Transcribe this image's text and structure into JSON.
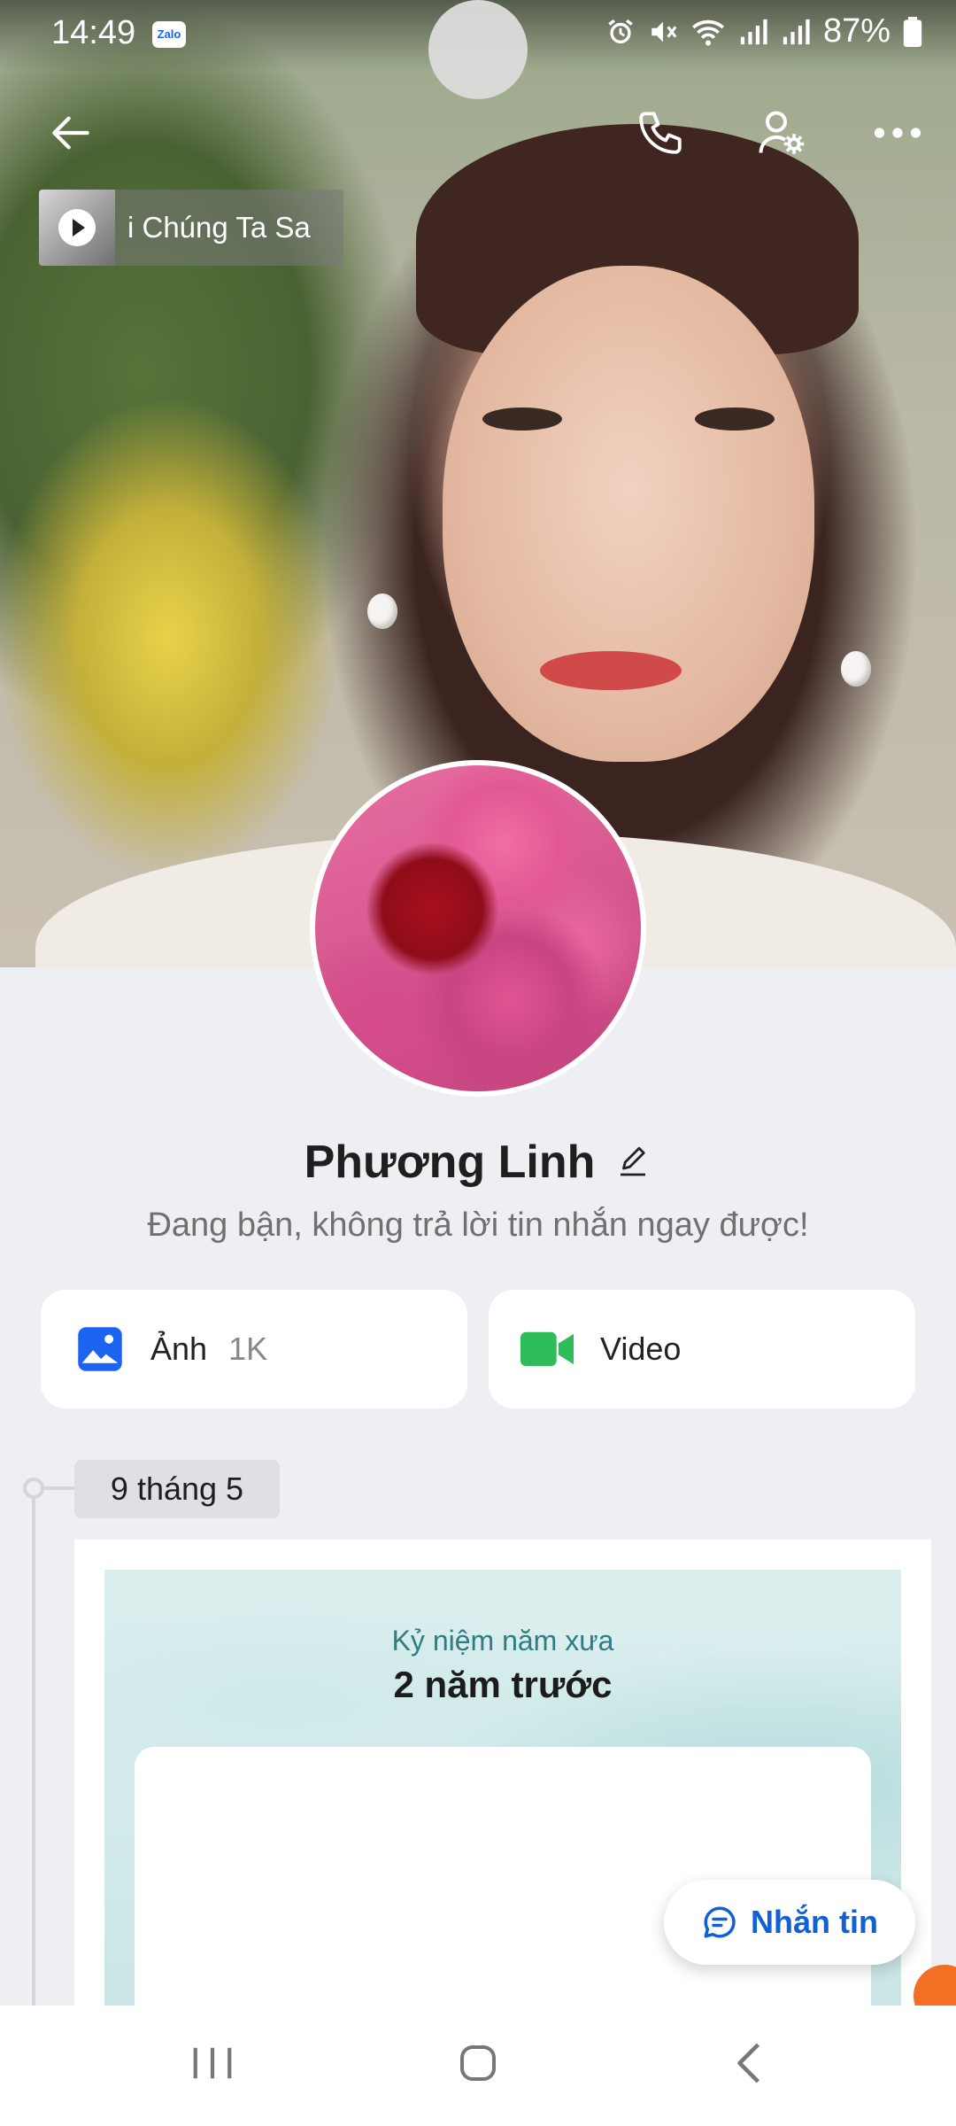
{
  "status_bar": {
    "time": "14:49",
    "app_badge": "Zalo",
    "battery": "87%"
  },
  "music": {
    "title": "i Chúng Ta Sa"
  },
  "profile": {
    "name": "Phương Linh",
    "status": "Đang bận, không trả lời tin nhắn ngay được!"
  },
  "media": {
    "photos_label": "Ảnh",
    "photos_count": "1K",
    "video_label": "Video"
  },
  "timeline": {
    "date": "9 tháng 5",
    "memory_label": "Kỷ niệm năm xưa",
    "memory_ago": "2 năm trước"
  },
  "fab": {
    "label": "Nhắn tin"
  },
  "colors": {
    "accent": "#1060d8",
    "photo_icon": "#1b64f2",
    "video_icon": "#2ebd5a",
    "background": "#eeeff3"
  }
}
